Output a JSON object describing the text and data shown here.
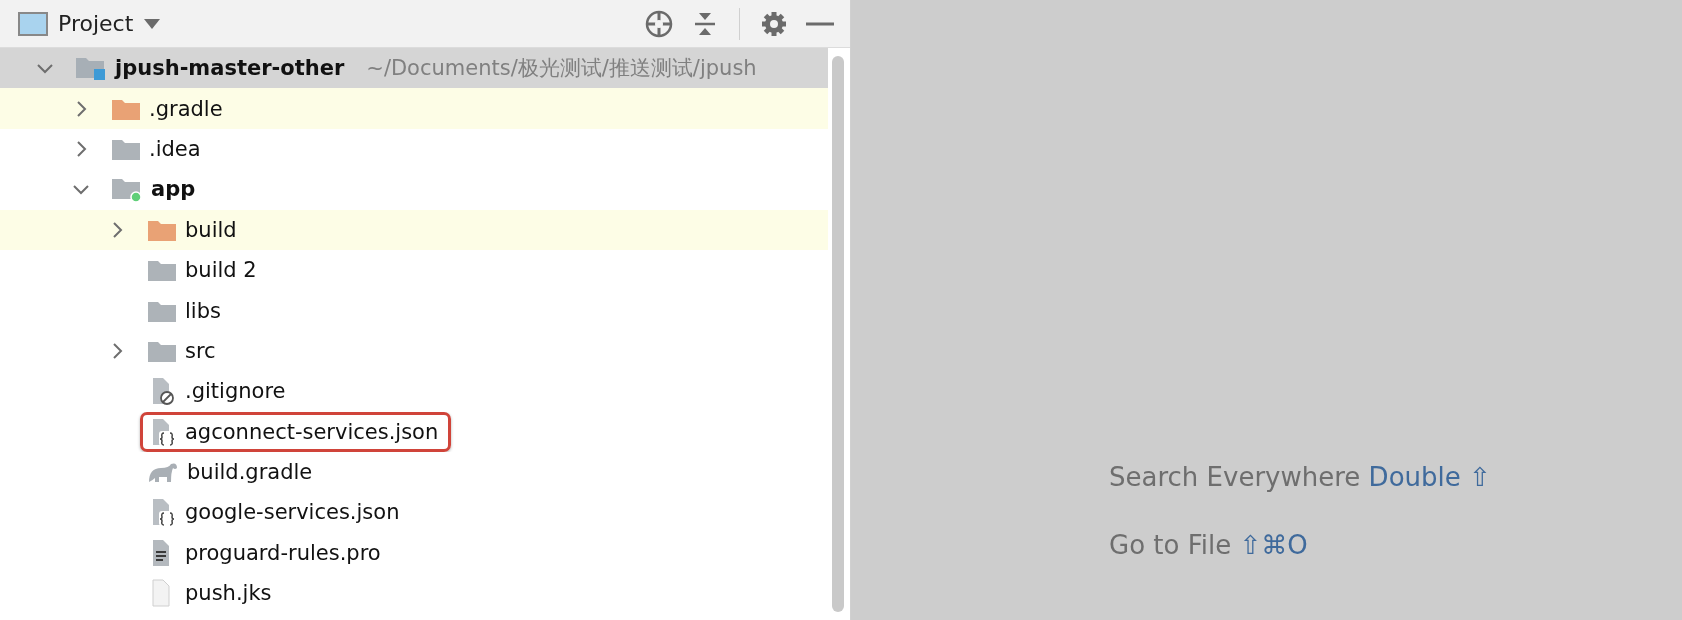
{
  "panel": {
    "title": "Project"
  },
  "tree": [
    {
      "name": "jpush-master-other",
      "kind": "project",
      "path": "~/Documents/极光测试/推送测试/jpush",
      "selected": true,
      "ignored": false,
      "outlined": false,
      "expanded": true,
      "children": [
        {
          "name": ".gradle",
          "kind": "excluded-folder",
          "selected": false,
          "ignored": true,
          "outlined": false,
          "expanded": false
        },
        {
          "name": ".idea",
          "kind": "folder",
          "selected": false,
          "ignored": false,
          "outlined": false,
          "expanded": false
        },
        {
          "name": "app",
          "kind": "module",
          "selected": false,
          "ignored": false,
          "outlined": false,
          "expanded": true,
          "children": [
            {
              "name": "build",
              "kind": "excluded-folder",
              "selected": false,
              "ignored": true,
              "outlined": false,
              "expanded": false
            },
            {
              "name": "build 2",
              "kind": "folder",
              "selected": false,
              "ignored": false,
              "outlined": false
            },
            {
              "name": "libs",
              "kind": "folder",
              "selected": false,
              "ignored": false,
              "outlined": false
            },
            {
              "name": "src",
              "kind": "folder",
              "selected": false,
              "ignored": false,
              "outlined": false,
              "expanded": false
            },
            {
              "name": ".gitignore",
              "kind": "ignore-file",
              "selected": false,
              "ignored": false,
              "outlined": false
            },
            {
              "name": "agconnect-services.json",
              "kind": "json-file",
              "selected": false,
              "ignored": false,
              "outlined": true
            },
            {
              "name": "build.gradle",
              "kind": "gradle-file",
              "selected": false,
              "ignored": false,
              "outlined": false
            },
            {
              "name": "google-services.json",
              "kind": "json-file",
              "selected": false,
              "ignored": false,
              "outlined": false
            },
            {
              "name": "proguard-rules.pro",
              "kind": "text-file",
              "selected": false,
              "ignored": false,
              "outlined": false
            },
            {
              "name": "push.jks",
              "kind": "plain-file",
              "selected": false,
              "ignored": false,
              "outlined": false
            }
          ]
        }
      ]
    }
  ],
  "hints": [
    {
      "label": "Search Everywhere",
      "shortcut": "Double ⇧"
    },
    {
      "label": "Go to File",
      "shortcut": "⇧⌘O"
    }
  ]
}
